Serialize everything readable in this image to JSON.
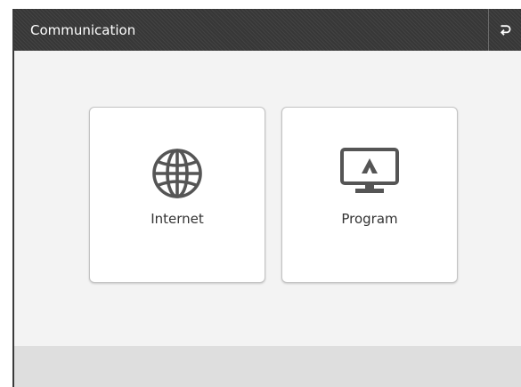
{
  "header": {
    "title": "Communication",
    "back_icon": "return-arrow-icon"
  },
  "tiles": [
    {
      "label": "Internet",
      "icon": "globe-icon"
    },
    {
      "label": "Program",
      "icon": "monitor-icon"
    }
  ],
  "colors": {
    "header_bg": "#373737",
    "content_bg": "#f3f3f3",
    "footer_bg": "#dedede",
    "tile_bg": "#ffffff",
    "icon": "#555555",
    "label": "#333333"
  }
}
